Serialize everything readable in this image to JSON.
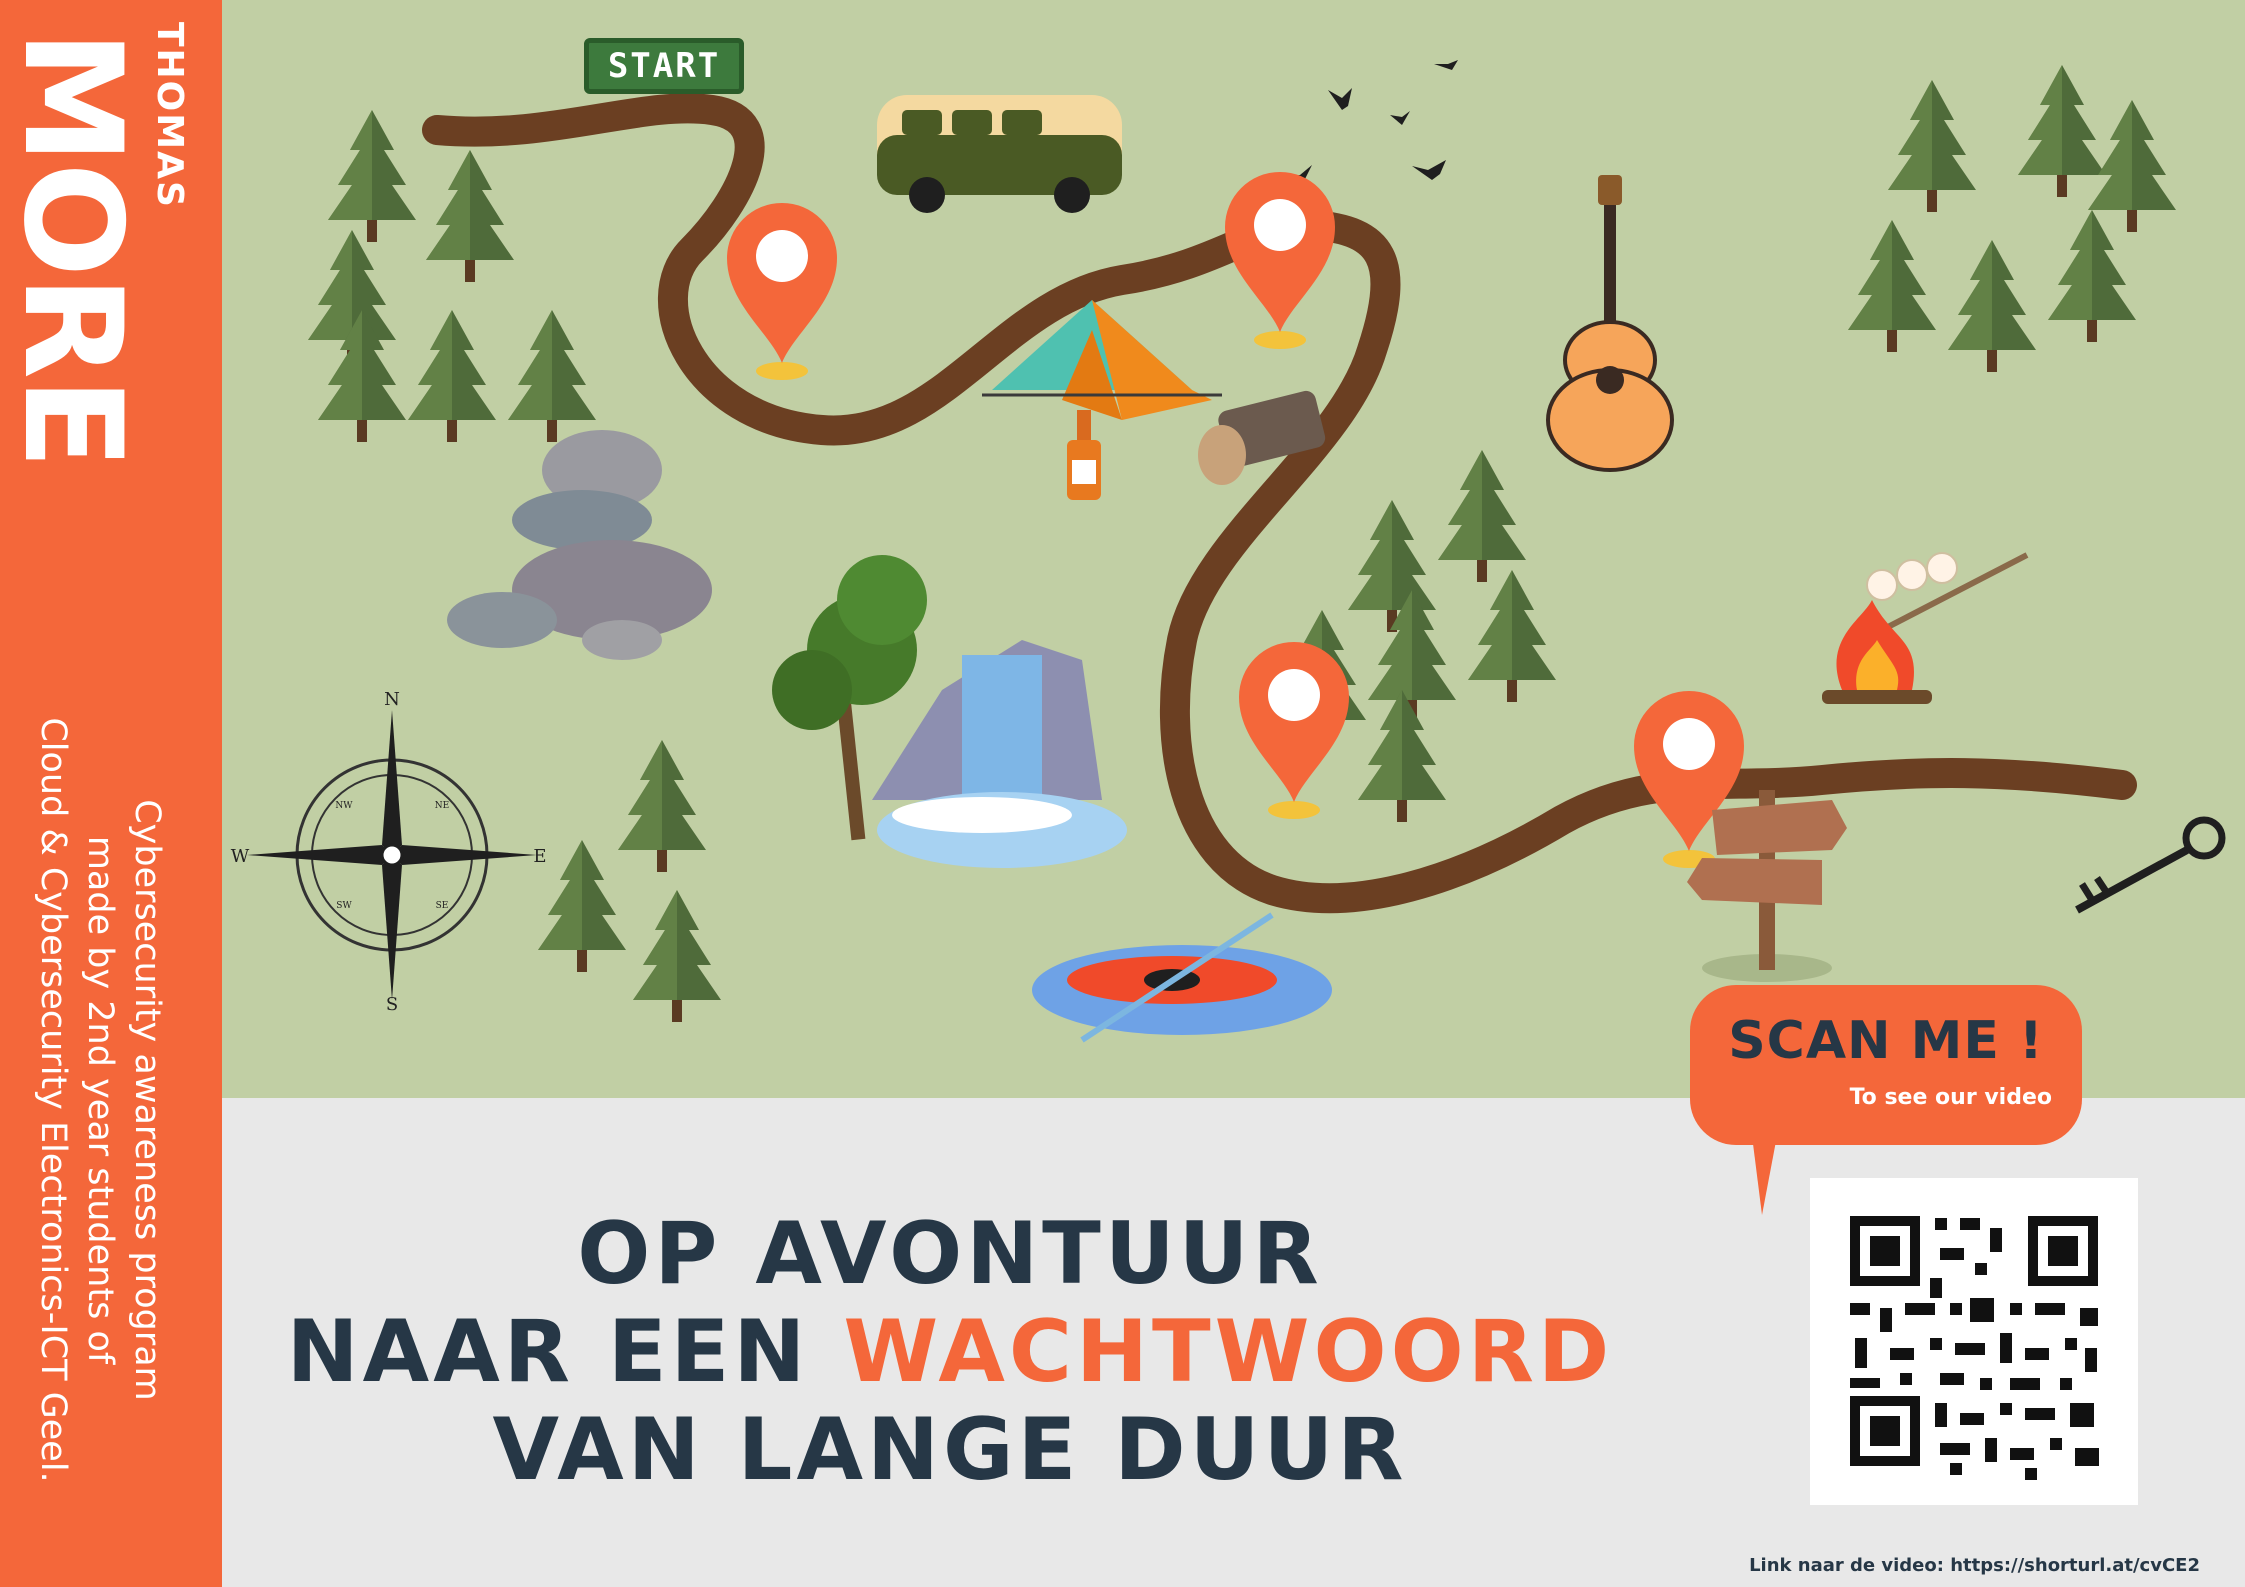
{
  "sidebar": {
    "logo_small": "THOMAS",
    "logo_large": "MORE",
    "lines": [
      "Cybersecurity awareness program",
      "made by 2nd year students of",
      "Cloud & Cybersecurity Electronics-ICT Geel."
    ]
  },
  "map": {
    "start_label": "START",
    "compass": {
      "n": "N",
      "s": "S",
      "e": "E",
      "w": "W",
      "ne": "NE",
      "nw": "NW",
      "se": "SE",
      "sw": "SW"
    },
    "illustrations": [
      "van",
      "tent",
      "bottle",
      "log",
      "guitar",
      "campfire",
      "waterfall",
      "rocks",
      "kayak",
      "signpost",
      "key",
      "birds",
      "pine-trees"
    ]
  },
  "title": {
    "line1": "OP AVONTUUR",
    "line2_prefix": "NAAR EEN ",
    "line2_accent": "WACHTWOORD",
    "line3": "VAN LANGE DUUR"
  },
  "scan": {
    "main": "SCAN ME !",
    "sub": "To see our video"
  },
  "footer": {
    "link": "Link naar de video: https://shorturl.at/cvCE2"
  },
  "colors": {
    "accent": "#f4673a",
    "navy": "#263746",
    "map_green": "#c1cfa4",
    "path_brown": "#6b3f22"
  }
}
